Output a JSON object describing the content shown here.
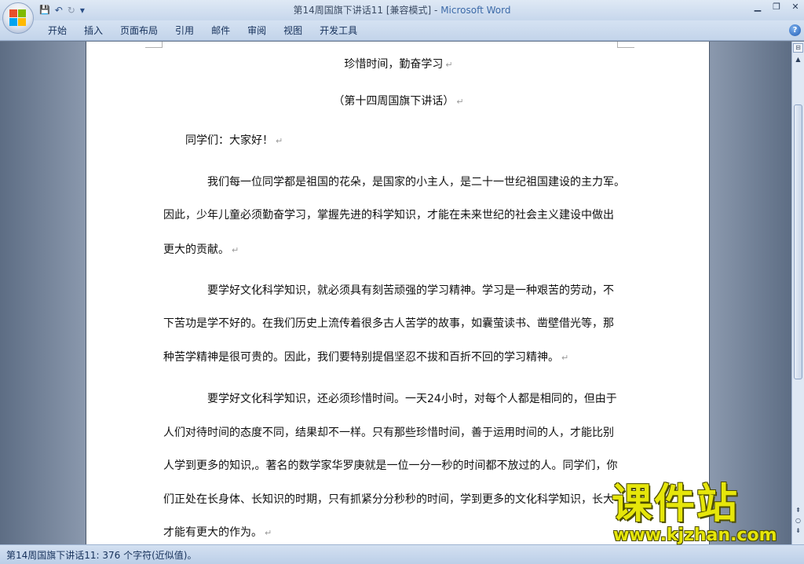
{
  "window": {
    "title_doc": "第14周国旗下讲话11 [兼容模式]",
    "title_sep": " - ",
    "title_app": "Microsoft Word",
    "controls": {
      "minimize": "▁",
      "restore": "❐",
      "close": "✕"
    }
  },
  "quick_access": {
    "save_icon": "💾",
    "undo_icon": "↶",
    "redo_icon": "↻",
    "customize_icon": "▾"
  },
  "ribbon": {
    "tabs": [
      "开始",
      "插入",
      "页面布局",
      "引用",
      "邮件",
      "审阅",
      "视图",
      "开发工具"
    ],
    "help_label": "?"
  },
  "document": {
    "para_mark": "↵",
    "lines": [
      "珍惜时间，勤奋学习",
      "（第十四周国旗下讲话）",
      "同学们：大家好！",
      "我们每一位同学都是祖国的花朵，是国家的小主人，是二十一世纪祖国建设的主力军。",
      "因此，少年儿童必须勤奋学习，掌握先进的科学知识，才能在未来世纪的社会主义建设中做出",
      "更大的贡献。",
      "要学好文化科学知识，就必须具有刻苦顽强的学习精神。学习是一种艰苦的劳动，不",
      "下苦功是学不好的。在我们历史上流传着很多古人苦学的故事，如囊萤读书、凿壁借光等，那",
      "种苦学精神是很可贵的。因此，我们要特别提倡坚忍不拔和百折不回的学习精神。",
      "要学好文化科学知识，还必须珍惜时间。一天24小时，对每个人都是相同的，但由于",
      "人们对待时间的态度不同，结果却不一样。只有那些珍惜时间，善于运用时间的人，才能比别",
      "人学到更多的知识,。著名的数学家华罗庚就是一位一分一秒的时间都不放过的人。同学们，你",
      "们正处在长身体、长知识的时期，只有抓紧分分秒秒的时间，学到更多的文化科学知识，长大",
      "才能有更大的作为。"
    ]
  },
  "scrollbar": {
    "ruler_icon": "⊟",
    "up_icon": "▲",
    "prev_icon": "⇞",
    "select_icon": "○",
    "next_icon": "⇟"
  },
  "status": {
    "text": "第14周国旗下讲话11: 376 个字符(近似值)。"
  },
  "watermark": {
    "top": "课件站",
    "bottom": "www.kjzhan.com"
  }
}
